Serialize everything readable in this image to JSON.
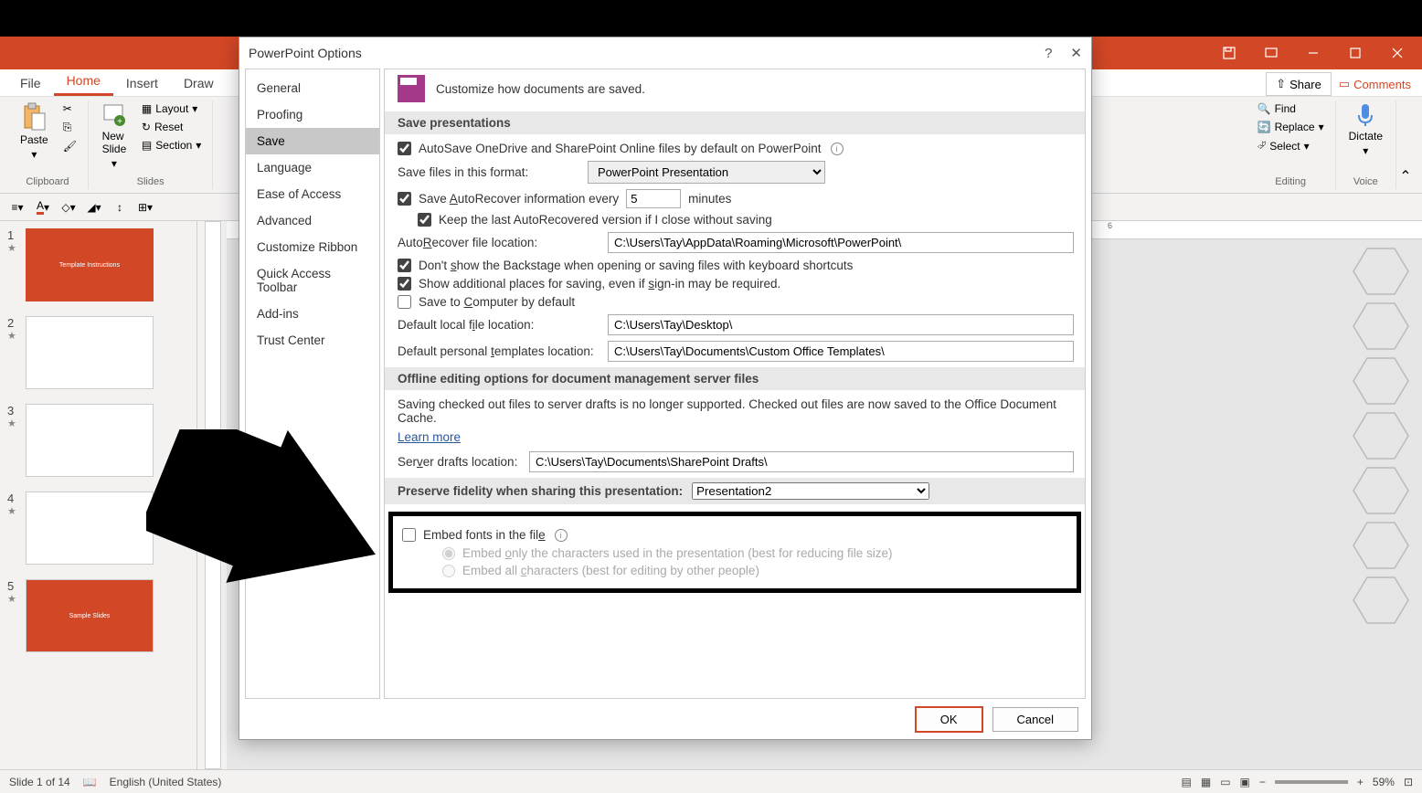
{
  "app": {
    "ribbon_tabs": [
      "File",
      "Home",
      "Insert",
      "Draw"
    ],
    "share_label": "Share",
    "comments_label": "Comments"
  },
  "ribbon": {
    "clipboard_label": "Clipboard",
    "paste_label": "Paste",
    "slides_label": "Slides",
    "new_slide_label": "New\nSlide",
    "layout_label": "Layout",
    "reset_label": "Reset",
    "section_label": "Section",
    "editing_label": "Editing",
    "find_label": "Find",
    "replace_label": "Replace",
    "select_label": "Select",
    "voice_label": "Voice",
    "dictate_label": "Dictate"
  },
  "ruler_mark": "6",
  "slides": [
    {
      "num": "1",
      "title": "Template Instructions"
    },
    {
      "num": "2",
      "title": ""
    },
    {
      "num": "3",
      "title": ""
    },
    {
      "num": "4",
      "title": ""
    },
    {
      "num": "5",
      "title": "Sample Slides"
    }
  ],
  "statusbar": {
    "slide_info": "Slide 1 of 14",
    "language": "English (United States)",
    "zoom": "59%"
  },
  "dialog": {
    "title": "PowerPoint Options",
    "sidebar": [
      "General",
      "Proofing",
      "Save",
      "Language",
      "Ease of Access",
      "Advanced",
      "Customize Ribbon",
      "Quick Access Toolbar",
      "Add-ins",
      "Trust Center"
    ],
    "header_text": "Customize how documents are saved.",
    "section1": "Save presentations",
    "autosave_label": "AutoSave OneDrive and SharePoint Online files by default on PowerPoint",
    "save_format_label": "Save files in this format:",
    "save_format_value": "PowerPoint Presentation",
    "autorecover_label": "Save AutoRecover information every",
    "autorecover_minutes": "5",
    "minutes_label": "minutes",
    "keep_last_label": "Keep the last AutoRecovered version if I close without saving",
    "autorecover_loc_label": "AutoRecover file location:",
    "autorecover_loc_value": "C:\\Users\\Tay\\AppData\\Roaming\\Microsoft\\PowerPoint\\",
    "dont_show_backstage": "Don't show the Backstage when opening or saving files with keyboard shortcuts",
    "show_additional": "Show additional places for saving, even if sign-in may be required.",
    "save_to_computer": "Save to Computer by default",
    "default_local_label": "Default local file location:",
    "default_local_value": "C:\\Users\\Tay\\Desktop\\",
    "default_templates_label": "Default personal templates location:",
    "default_templates_value": "C:\\Users\\Tay\\Documents\\Custom Office Templates\\",
    "section2": "Offline editing options for document management server files",
    "offline_note": "Saving checked out files to server drafts is no longer supported. Checked out files are now saved to the Office Document Cache.",
    "learn_more": "Learn more",
    "server_drafts_label": "Server drafts location:",
    "server_drafts_value": "C:\\Users\\Tay\\Documents\\SharePoint Drafts\\",
    "section3": "Preserve fidelity when sharing this presentation:",
    "presentation_name": "Presentation2",
    "embed_fonts": "Embed fonts in the file",
    "embed_only": "Embed only the characters used in the presentation (best for reducing file size)",
    "embed_all": "Embed all characters (best for editing by other people)",
    "ok_label": "OK",
    "cancel_label": "Cancel"
  }
}
